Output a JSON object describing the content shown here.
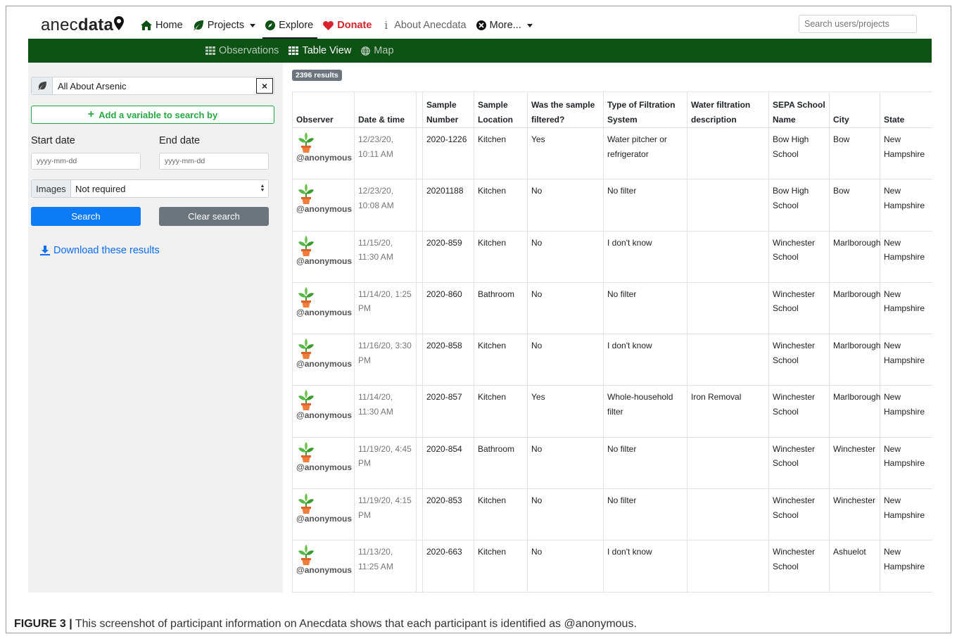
{
  "brand": {
    "logo_light": "anec",
    "logo_bold": "data"
  },
  "nav": {
    "home": "Home",
    "projects": "Projects",
    "explore": "Explore",
    "donate": "Donate",
    "about": "About Anecdata",
    "more": "More..."
  },
  "search_top": {
    "placeholder": "Search users/projects"
  },
  "subnav": {
    "observations": "Observations",
    "table_view": "Table View",
    "map": "Map"
  },
  "sidebar": {
    "project": "All About Arsenic",
    "clear_symbol": "×",
    "add_variable": "Add a variable to search by",
    "start_date_label": "Start date",
    "end_date_label": "End date",
    "date_placeholder": "yyyy-mm-dd",
    "images_label": "Images",
    "images_value": "Not required",
    "search_button": "Search",
    "clear_button": "Clear search",
    "download": "Download these results"
  },
  "results": {
    "count_badge": "2396 results",
    "columns": [
      "Observer",
      "Date & time",
      "",
      "Sample Number",
      "Sample Location",
      "Was the sample filtered?",
      "Type of Filtration System",
      "Water filtration description",
      "SEPA School Name",
      "City",
      "State"
    ],
    "rows": [
      {
        "observer": "@anonymous",
        "date": "12/23/20, 10:11 AM",
        "sample_number": "2020-1226",
        "location": "Kitchen",
        "filtered": "Yes",
        "filtration_type": "Water pitcher or refrigerator",
        "description": "",
        "school": "Bow High School",
        "city": "Bow",
        "state": "New Hampshire"
      },
      {
        "observer": "@anonymous",
        "date": "12/23/20, 10:08 AM",
        "sample_number": "20201188",
        "location": "Kitchen",
        "filtered": "No",
        "filtration_type": "No filter",
        "description": "",
        "school": "Bow High School",
        "city": "Bow",
        "state": "New Hampshire"
      },
      {
        "observer": "@anonymous",
        "date": "11/15/20, 11:30 AM",
        "sample_number": "2020-859",
        "location": "Kitchen",
        "filtered": "No",
        "filtration_type": "I don't know",
        "description": "",
        "school": "Winchester School",
        "city": "Marlborough",
        "state": "New Hampshire"
      },
      {
        "observer": "@anonymous",
        "date": "11/14/20, 1:25 PM",
        "sample_number": "2020-860",
        "location": "Bathroom",
        "filtered": "No",
        "filtration_type": "No filter",
        "description": "",
        "school": "Winchester School",
        "city": "Marlborough",
        "state": "New Hampshire"
      },
      {
        "observer": "@anonymous",
        "date": "11/16/20, 3:30 PM",
        "sample_number": "2020-858",
        "location": "Kitchen",
        "filtered": "No",
        "filtration_type": "I don't know",
        "description": "",
        "school": "Winchester School",
        "city": "Marlborough",
        "state": "New Hampshire"
      },
      {
        "observer": "@anonymous",
        "date": "11/14/20, 11:30 AM",
        "sample_number": "2020-857",
        "location": "Kitchen",
        "filtered": "Yes",
        "filtration_type": "Whole-household filter",
        "description": "Iron Removal",
        "school": "Winchester School",
        "city": "Marlborough",
        "state": "New Hampshire"
      },
      {
        "observer": "@anonymous",
        "date": "11/19/20, 4:45 PM",
        "sample_number": "2020-854",
        "location": "Bathroom",
        "filtered": "No",
        "filtration_type": "No filter",
        "description": "",
        "school": "Winchester School",
        "city": "Winchester",
        "state": "New Hampshire"
      },
      {
        "observer": "@anonymous",
        "date": "11/19/20, 4:15 PM",
        "sample_number": "2020-853",
        "location": "Kitchen",
        "filtered": "No",
        "filtration_type": "No filter",
        "description": "",
        "school": "Winchester School",
        "city": "Winchester",
        "state": "New Hampshire"
      },
      {
        "observer": "@anonymous",
        "date": "11/13/20, 11:25 AM",
        "sample_number": "2020-663",
        "location": "Kitchen",
        "filtered": "No",
        "filtration_type": "I don't know",
        "description": "",
        "school": "Winchester School",
        "city": "Ashuelot",
        "state": "New Hampshire"
      }
    ]
  },
  "caption": {
    "label": "FIGURE 3 |",
    "text": " This screenshot of participant information on Anecdata shows that each participant is identified as @anonymous."
  },
  "colors": {
    "brand_green": "#0b5214",
    "donate_red": "#d9232d",
    "primary_blue": "#0d7bf5",
    "success_green": "#28a745",
    "secondary_gray": "#6c757d"
  }
}
